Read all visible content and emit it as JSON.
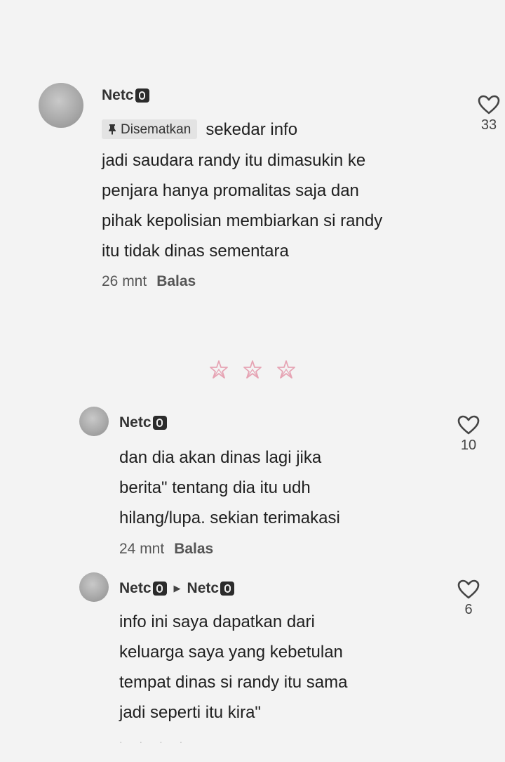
{
  "comments": [
    {
      "username": "Netc",
      "pinned_label": "Disematkan",
      "first_line": "sekedar info",
      "lines": [
        "jadi saudara randy itu dimasukin ke",
        "penjara hanya promalitas saja dan",
        "pihak kepolisian membiarkan si randy",
        "itu tidak dinas sementara"
      ],
      "time": "26 mnt",
      "reply_label": "Balas",
      "likes": "33"
    }
  ],
  "replies": [
    {
      "username": "Netc",
      "lines": [
        "dan dia akan dinas lagi jika",
        "berita\" tentang dia itu udh",
        "hilang/lupa. sekian terimakasi"
      ],
      "time": "24 mnt",
      "reply_label": "Balas",
      "likes": "10"
    },
    {
      "username": "Netc",
      "reply_to": "Netc",
      "lines": [
        "info ini saya dapatkan dari",
        "keluarga saya yang kebetulan",
        "tempat dinas si randy itu sama",
        "jadi seperti itu kira\""
      ],
      "likes": "6"
    }
  ],
  "colors": {
    "stars": "#e6a4b4",
    "badge": "#2b2b2b",
    "pinned_bg": "#e3e3e3"
  },
  "icons": {
    "like": "heart-outline-icon",
    "pin": "pin-icon",
    "badge": "creator-badge-icon"
  }
}
